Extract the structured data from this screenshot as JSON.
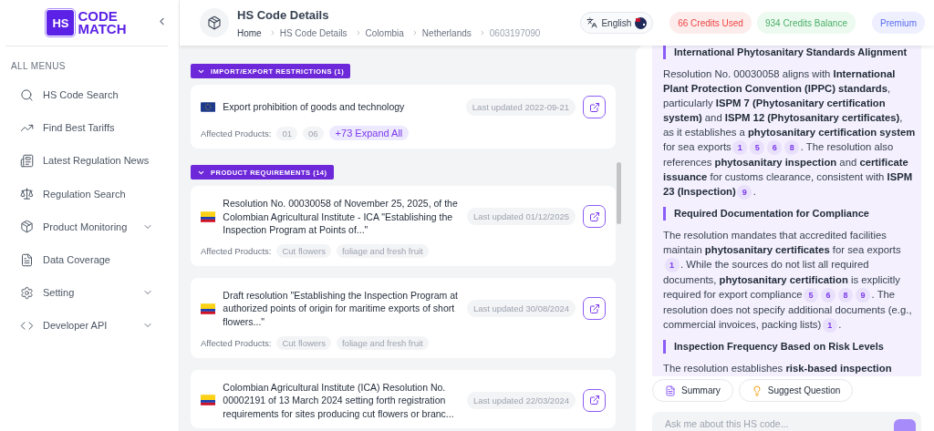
{
  "sidebar": {
    "logo": {
      "badge": "HS",
      "line1": "CODE",
      "line2": "MATCH"
    },
    "section_label": "ALL MENUS",
    "items": [
      {
        "label": "HS Code Search",
        "has_submenu": false
      },
      {
        "label": "Find Best Tariffs",
        "has_submenu": false
      },
      {
        "label": "Latest Regulation News",
        "has_submenu": false
      },
      {
        "label": "Regulation Search",
        "has_submenu": false
      },
      {
        "label": "Product Monitoring",
        "has_submenu": true
      },
      {
        "label": "Data Coverage",
        "has_submenu": false
      },
      {
        "label": "Setting",
        "has_submenu": true
      },
      {
        "label": "Developer API",
        "has_submenu": true
      }
    ]
  },
  "header": {
    "title": "HS Code Details",
    "breadcrumbs": [
      {
        "label": "Home",
        "current": false
      },
      {
        "label": "HS Code Details",
        "current": false
      },
      {
        "label": "Colombia",
        "current": false
      },
      {
        "label": "Netherlands",
        "current": false
      },
      {
        "label": "0603197090",
        "current": true
      }
    ],
    "language": "English",
    "credits_used": "66 Credits Used",
    "credits_balance": "934 Credits Balance",
    "plan": "Premium"
  },
  "sections": [
    {
      "title": "IMPORT/EXPORT RESTRICTIONS (1)",
      "expanded": true,
      "cards": [
        {
          "kind": "eu",
          "title": "Export prohibition of goods and technology",
          "updated": "Last updated 2022-09-21",
          "affected_label": "Affected Products:",
          "products": [
            "01",
            "06"
          ],
          "more": "+73 Expand All"
        }
      ]
    },
    {
      "title": "PRODUCT REQUIREMENTS (14)",
      "expanded": true,
      "cards": [
        {
          "kind": "colombia",
          "title": "Resolution No. 00030058 of November 25, 2025, of the Colombian Agricultural Institute - ICA \"Establishing the Inspection Program at Points of...\"",
          "updated": "Last updated 01/12/2025",
          "affected_label": "Affected Products:",
          "products": [
            "Cut flowers",
            "foliage and fresh fruit"
          ]
        },
        {
          "kind": "colombia",
          "title": "Draft resolution \"Establishing the Inspection Program at authorized points of origin for maritime exports of short flowers...\"",
          "updated": "Last updated 30/08/2024",
          "affected_label": "Affected Products:",
          "products": [
            "Cut flowers",
            "foliage and fresh fruit"
          ]
        },
        {
          "kind": "colombia",
          "title": "Colombian Agricultural Institute (ICA) Resolution No. 00002191 of 13 March 2024 setting forth registration requirements for sites producing cut flowers or branc...",
          "updated": "Last updated 22/03/2024"
        }
      ]
    }
  ],
  "chat": {
    "blocks": [
      {
        "kind": "heading",
        "text": "International Phytosanitary Standards Alignment"
      },
      {
        "kind": "paragraph",
        "parts": [
          {
            "kind": "text",
            "text": "Resolution No. 00030058 aligns with **International Plant Protection Convention (IPPC) standards**, particularly **ISPM 7 (Phytosanitary certification system)** and **ISPM 12 (Phytosanitary certificates)**, as it establishes a **phytosanitary certification system** for sea exports"
          },
          {
            "kind": "cite",
            "text": "1"
          },
          {
            "kind": "cite",
            "text": "5"
          },
          {
            "kind": "cite",
            "text": "6"
          },
          {
            "kind": "cite",
            "text": "8"
          },
          {
            "kind": "text",
            "text": ". The resolution also references **phytosanitary inspection** and **certificate issuance** for customs clearance, consistent with **ISPM 23 (Inspection)**"
          },
          {
            "kind": "cite",
            "text": "9"
          },
          {
            "kind": "text",
            "text": "."
          }
        ]
      },
      {
        "kind": "heading",
        "text": "Required Documentation for Compliance"
      },
      {
        "kind": "paragraph",
        "parts": [
          {
            "kind": "text",
            "text": "The resolution mandates that accredited facilities maintain **phytosanitary certificates** for sea exports"
          },
          {
            "kind": "cite",
            "text": "1"
          },
          {
            "kind": "text",
            "text": ". While the sources do not list all required documents, **phytosanitary certification** is explicitly required for export compliance"
          },
          {
            "kind": "cite",
            "text": "5"
          },
          {
            "kind": "cite",
            "text": "6"
          },
          {
            "kind": "cite",
            "text": "8"
          },
          {
            "kind": "cite",
            "text": "9"
          },
          {
            "kind": "text",
            "text": ". The resolution does not specify additional documents (e.g., commercial invoices, packing lists)"
          },
          {
            "kind": "cite",
            "text": "1"
          },
          {
            "kind": "text",
            "text": "."
          }
        ]
      },
      {
        "kind": "heading",
        "text": "Inspection Frequency Based on Risk Levels"
      },
      {
        "kind": "paragraph",
        "parts": [
          {
            "kind": "text",
            "text": "The resolution establishes **risk-based inspection**"
          }
        ]
      }
    ],
    "actions": [
      {
        "label": "Summary"
      },
      {
        "label": "Suggest Question"
      }
    ],
    "input": {
      "placeholder": "Ask me about this HS code..."
    }
  }
}
